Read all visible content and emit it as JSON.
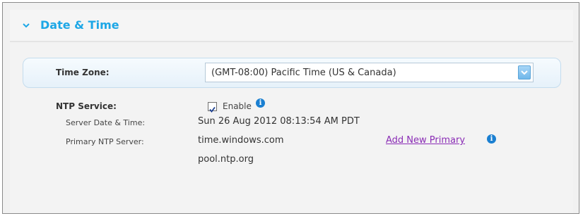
{
  "section": {
    "title": "Date & Time"
  },
  "time_zone": {
    "label": "Time Zone:",
    "selected": "(GMT-08:00) Pacific Time (US & Canada)"
  },
  "ntp": {
    "label": "NTP Service:",
    "enable_label": "Enable",
    "enabled": true,
    "server_date_label": "Server Date & Time:",
    "server_date_value": "Sun 26 Aug 2012 08:13:54 AM PDT",
    "primary_label": "Primary NTP Server:",
    "primary_value": "time.windows.com",
    "add_primary_link": "Add New Primary",
    "secondary_value": "pool.ntp.org"
  },
  "icons": {
    "chevron": "chevron-down-icon",
    "info": "info-icon",
    "checkmark": "checkmark-icon",
    "dropdown": "dropdown-arrow-icon"
  },
  "colors": {
    "accent": "#1da7e6",
    "info_blue": "#1a7fd1",
    "link": "#8a2cb5"
  }
}
